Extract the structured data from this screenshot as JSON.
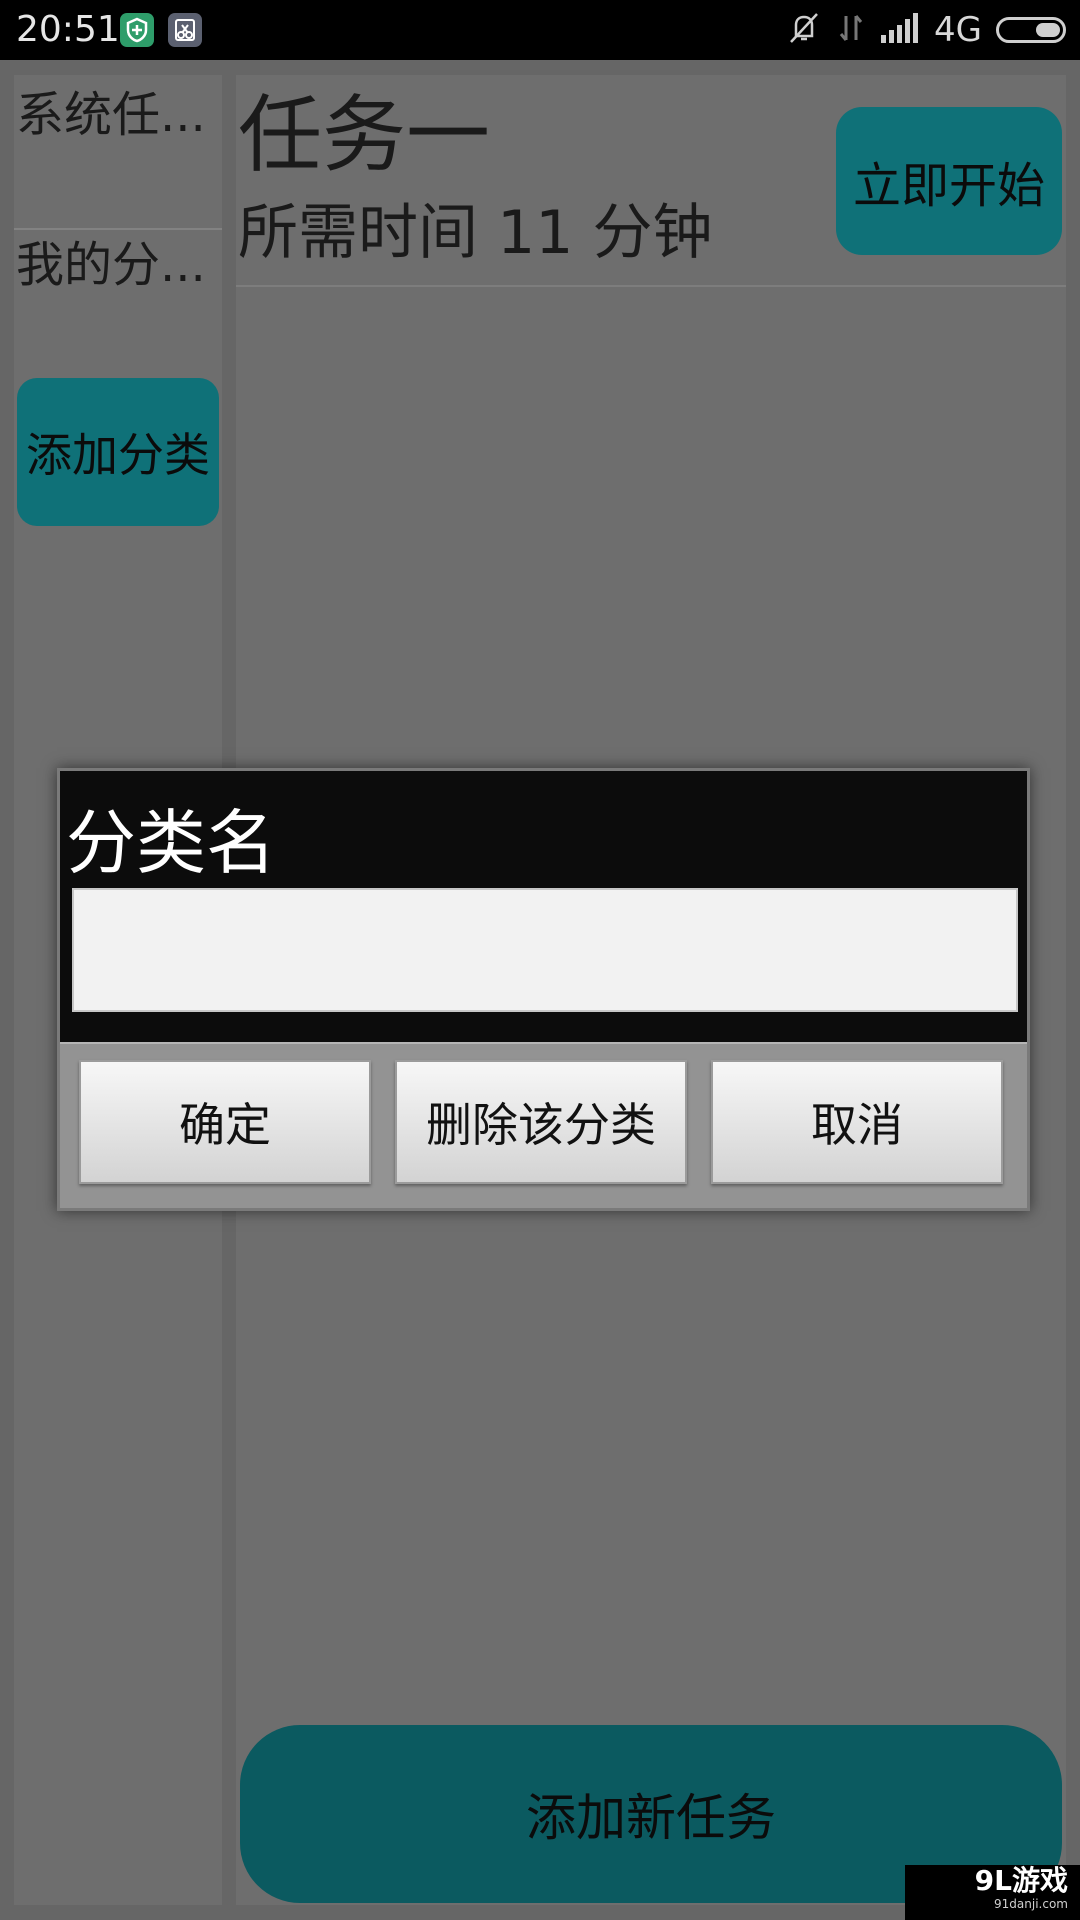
{
  "status_bar": {
    "time": "20:51",
    "network": "4G",
    "icons": [
      "shield-app-icon",
      "scissors-app-icon",
      "mute-icon",
      "data-arrows-icon",
      "signal-icon",
      "battery-icon"
    ]
  },
  "sidebar": {
    "categories": [
      {
        "label": "系统任..."
      },
      {
        "label": "我的分..."
      }
    ],
    "add_category_label": "添加分类"
  },
  "task": {
    "title": "任务一",
    "duration": "所需时间  11 分钟",
    "start_label": "立即开始"
  },
  "add_task_label": "添加新任务",
  "dialog": {
    "title": "分类名",
    "input_value": "",
    "confirm_label": "确定",
    "delete_label": "删除该分类",
    "cancel_label": "取消"
  },
  "watermark": {
    "brand": "9L游戏",
    "url": "91danji.com"
  },
  "colors": {
    "accent": "#0f7178",
    "overlay_bg": "#666666",
    "dialog_bg": "#0c0c0c"
  }
}
